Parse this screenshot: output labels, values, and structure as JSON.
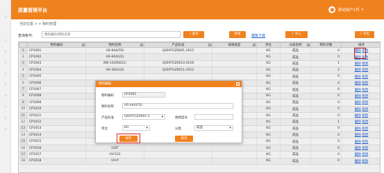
{
  "app": {
    "title": "质量管理平台",
    "user": "测试用户1号",
    "user_caret": "▾"
  },
  "breadcrumb": "当前位置 > > 物料管理",
  "toolbar": {
    "query_label": "查询条件:",
    "query_placeholder": "物料编码/物料名称",
    "search_button": "查询",
    "add_button": "新增",
    "template_link": "模板下载",
    "import_button": "导入",
    "export_button": "导出"
  },
  "table": {
    "columns": [
      "物料编码",
      "物料名称",
      "产品标准",
      "规格类型",
      "单位",
      "分类名称",
      "物料次数",
      "操作"
    ],
    "rows": [
      {
        "n": "1",
        "code": "CP1001",
        "name": "HS-944(FD)",
        "std": "Q/DXTGZ0001-2015",
        "spec": "",
        "unit": "KG",
        "cat": "成品",
        "cnt": "0",
        "del": "删除",
        "edit": "修改"
      },
      {
        "n": "2",
        "code": "CP1002",
        "name": "HS-944(LD)",
        "std": "",
        "spec": "",
        "unit": "KG",
        "cat": "成品",
        "cnt": "0",
        "del": "删除",
        "edit": "修改"
      },
      {
        "n": "3",
        "code": "CP1003",
        "name": "BW-10(DS622)",
        "std": "Q/DXTGZ0010-2016",
        "spec": "",
        "unit": "KG",
        "cat": "成品",
        "cnt": "1",
        "del": "删除",
        "edit": "修改"
      },
      {
        "n": "4",
        "code": "CP1004",
        "name": "HS-362(LD)",
        "std": "Q/DXTGZ0011-2012",
        "spec": "",
        "unit": "KG",
        "cat": "成品",
        "cnt": "2",
        "del": "删除",
        "edit": "修改"
      },
      {
        "n": "5",
        "code": "CP1005",
        "name": "",
        "std": "",
        "spec": "",
        "unit": "KG",
        "cat": "成品",
        "cnt": "0",
        "del": "删除",
        "edit": "修改"
      },
      {
        "n": "6",
        "code": "CP1006",
        "name": "",
        "std": "",
        "spec": "",
        "unit": "KG",
        "cat": "成品",
        "cnt": "0",
        "del": "删除",
        "edit": "修改"
      },
      {
        "n": "7",
        "code": "CP1007",
        "name": "",
        "std": "",
        "spec": "",
        "unit": "KG",
        "cat": "成品",
        "cnt": "0",
        "del": "删除",
        "edit": "修改"
      },
      {
        "n": "8",
        "code": "CP1008",
        "name": "",
        "std": "",
        "spec": "",
        "unit": "KG",
        "cat": "成品",
        "cnt": "0",
        "del": "删除",
        "edit": "修改"
      },
      {
        "n": "9",
        "code": "CP1009",
        "name": "",
        "std": "",
        "spec": "",
        "unit": "KG",
        "cat": "成品",
        "cnt": "0",
        "del": "删除",
        "edit": "修改"
      },
      {
        "n": "10",
        "code": "CP1010",
        "name": "",
        "std": "",
        "spec": "",
        "unit": "KG",
        "cat": "成品",
        "cnt": "0",
        "del": "删除",
        "edit": "修改"
      },
      {
        "n": "11",
        "code": "CP1011",
        "name": "",
        "std": "",
        "spec": "",
        "unit": "KG",
        "cat": "成品",
        "cnt": "0",
        "del": "删除",
        "edit": "修改"
      },
      {
        "n": "12",
        "code": "CP1012",
        "name": "",
        "std": "",
        "spec": "",
        "unit": "KG",
        "cat": "成品",
        "cnt": "1",
        "del": "删除",
        "edit": "修改"
      },
      {
        "n": "13",
        "code": "CP1013",
        "name": "",
        "std": "",
        "spec": "",
        "unit": "KG",
        "cat": "成品",
        "cnt": "0",
        "del": "删除",
        "edit": "修改"
      },
      {
        "n": "14",
        "code": "CP1014",
        "name": "",
        "std": "",
        "spec": "",
        "unit": "KG",
        "cat": "成品",
        "cnt": "0",
        "del": "删除",
        "edit": "修改"
      },
      {
        "n": "15",
        "code": "CP1015",
        "name": "HS-156",
        "std": "",
        "spec": "",
        "unit": "KG",
        "cat": "成品",
        "cnt": "0",
        "del": "删除",
        "edit": "修改"
      },
      {
        "n": "16",
        "code": "CP1016",
        "name": "156T",
        "std": "",
        "spec": "",
        "unit": "KG",
        "cat": "成品",
        "cnt": "0",
        "del": "删除",
        "edit": "修改"
      },
      {
        "n": "17",
        "code": "CP1017",
        "name": "UV-531",
        "std": "",
        "spec": "",
        "unit": "KG",
        "cat": "成品",
        "cnt": "0",
        "del": "删除",
        "edit": "修改"
      },
      {
        "n": "18",
        "code": "CP1018",
        "name": "UV-P",
        "std": "",
        "spec": "",
        "unit": "KG",
        "cat": "成品",
        "cnt": "0",
        "del": "删除",
        "edit": "修改"
      }
    ]
  },
  "modal": {
    "title": "物料编辑",
    "code_label": "物料编码",
    "code_value": "CP1001",
    "name_label": "物料名称",
    "name_value": "HS-944(FD)",
    "std_label": "产品标准",
    "std_value": "Q/DXTGZ0001-2",
    "spec_label": "规格型号",
    "spec_value": "",
    "unit_label": "单位",
    "unit_value": "KG",
    "cat_label": "分类",
    "cat_value": "成品",
    "save_button": "保存",
    "cancel_button": "取消"
  },
  "colors": {
    "accent": "#f0821e",
    "highlight": "#e02020",
    "link": "#1a5fd6"
  }
}
